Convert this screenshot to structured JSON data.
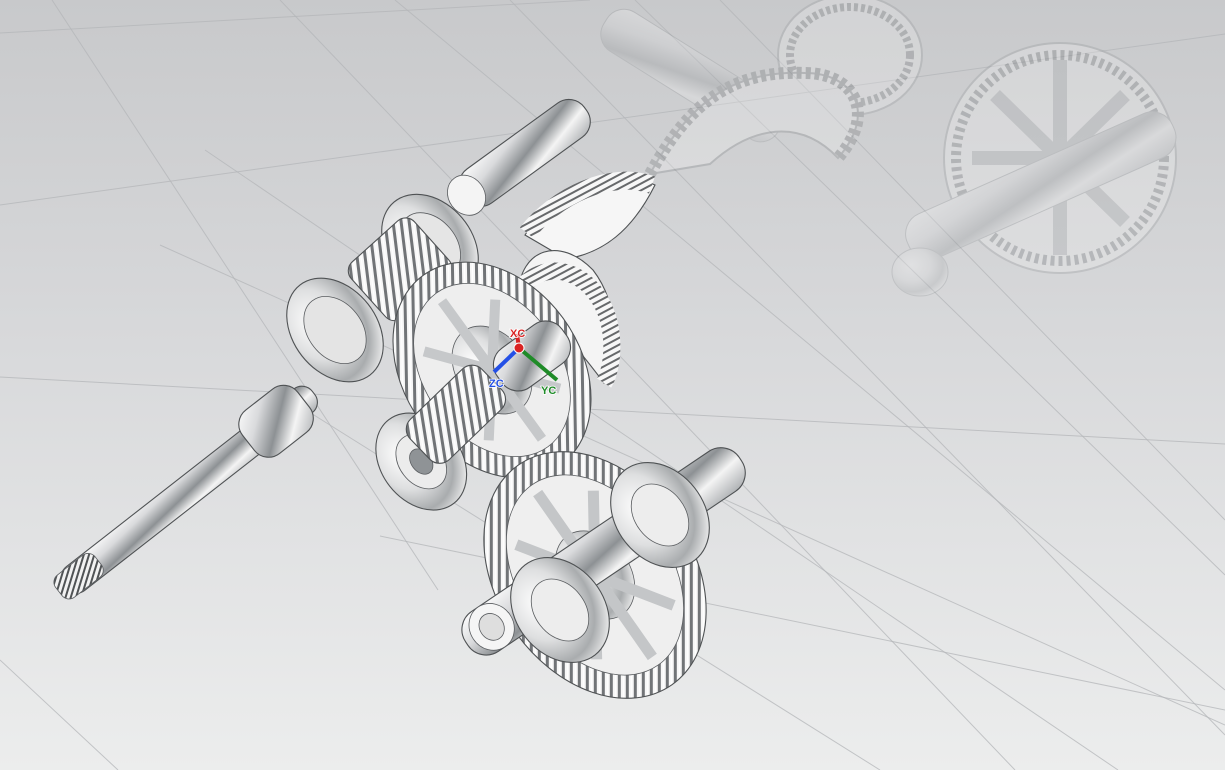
{
  "viewport": {
    "background_top": "#c8c9cb",
    "background_bottom": "#eceded",
    "model_color": "#e8e9ea",
    "ghost_model_color": "#d2d4d6"
  },
  "triad": {
    "x_label": "XC",
    "y_label": "YC",
    "z_label": "ZC",
    "x_color": "#d92323",
    "y_color": "#1f8b28",
    "z_color": "#2450e6"
  },
  "icons": {
    "coordinate_system": "coordinate-triad-icon"
  }
}
